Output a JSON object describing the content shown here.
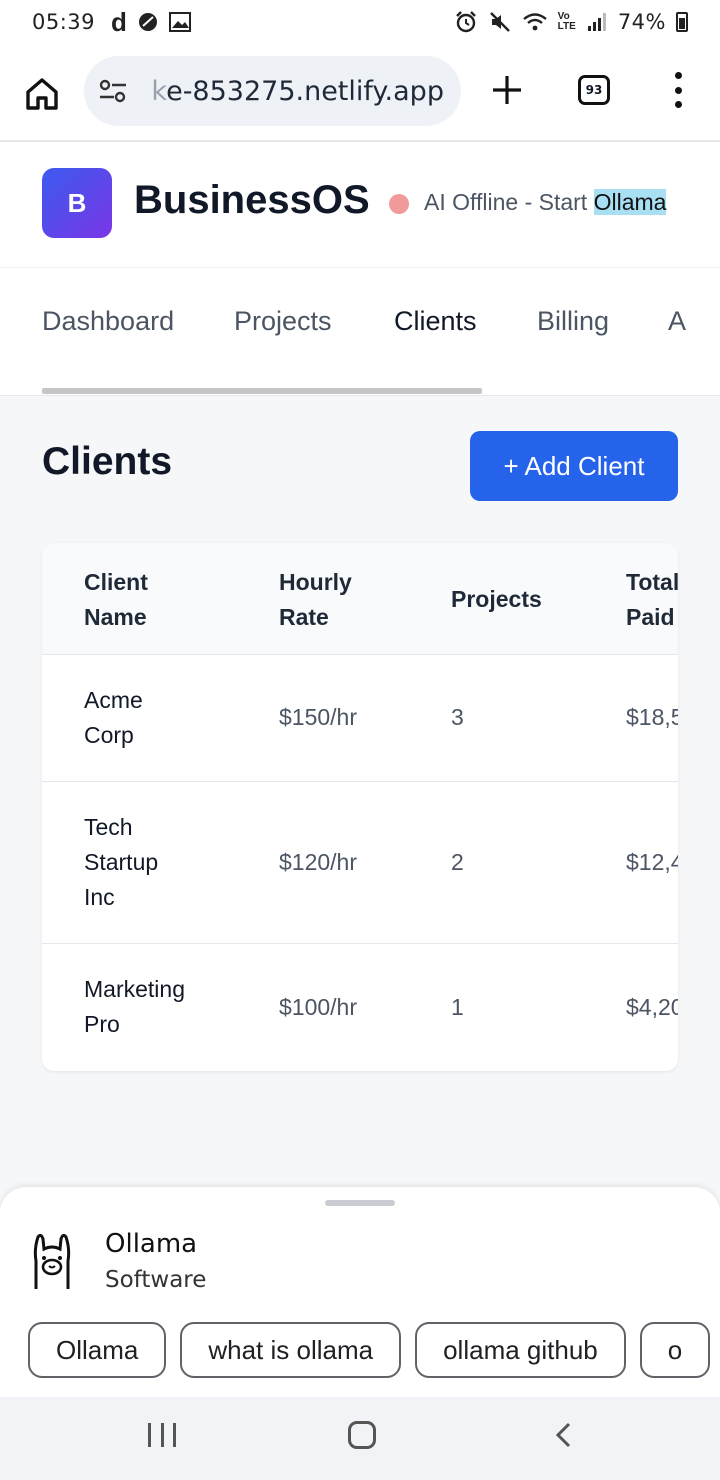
{
  "status_bar": {
    "time": "05:39",
    "notif_letter": "d",
    "battery": "74%",
    "icons": [
      "alarm-icon",
      "mute-icon",
      "wifi-icon",
      "volte-icon",
      "signal-icon",
      "battery-icon"
    ]
  },
  "browser": {
    "url_prefix": " k",
    "url": "e-853275.netlify.app",
    "tab_count": "93"
  },
  "app": {
    "logo_letter": "B",
    "title": "BusinessOS",
    "ai_status_prefix": "AI Offline - Start ",
    "ai_status_highlight": "Ollama",
    "status_color": "#f19a9a"
  },
  "nav": {
    "tabs": [
      "Dashboard",
      "Projects",
      "Clients",
      "Billing",
      "A"
    ],
    "active_tab": "Clients"
  },
  "main": {
    "title": "Clients",
    "add_button": "+ Add Client"
  },
  "table": {
    "headers": [
      {
        "line1": "Client",
        "line2": "Name"
      },
      {
        "line1": "Hourly",
        "line2": "Rate"
      },
      {
        "line1": "Projects",
        "line2": ""
      },
      {
        "line1": "Total",
        "line2": "Paid"
      }
    ],
    "rows": [
      {
        "name_lines": [
          "Acme",
          "Corp"
        ],
        "rate": "$150/hr",
        "projects": "3",
        "total": "$18,5"
      },
      {
        "name_lines": [
          "Tech",
          "Startup",
          "Inc"
        ],
        "rate": "$120/hr",
        "projects": "2",
        "total": "$12,4"
      },
      {
        "name_lines": [
          "Marketing",
          "Pro"
        ],
        "rate": "$100/hr",
        "projects": "1",
        "total": "$4,20"
      }
    ]
  },
  "sheet": {
    "name": "Ollama",
    "subtitle": "Software",
    "chips": [
      "Ollama",
      "what is ollama",
      "ollama github",
      "o"
    ]
  },
  "colors": {
    "accent": "#2563eb",
    "logo_gradient_start": "#3b5bf0",
    "logo_gradient_end": "#7a36e6",
    "highlight": "#a8dff3"
  }
}
